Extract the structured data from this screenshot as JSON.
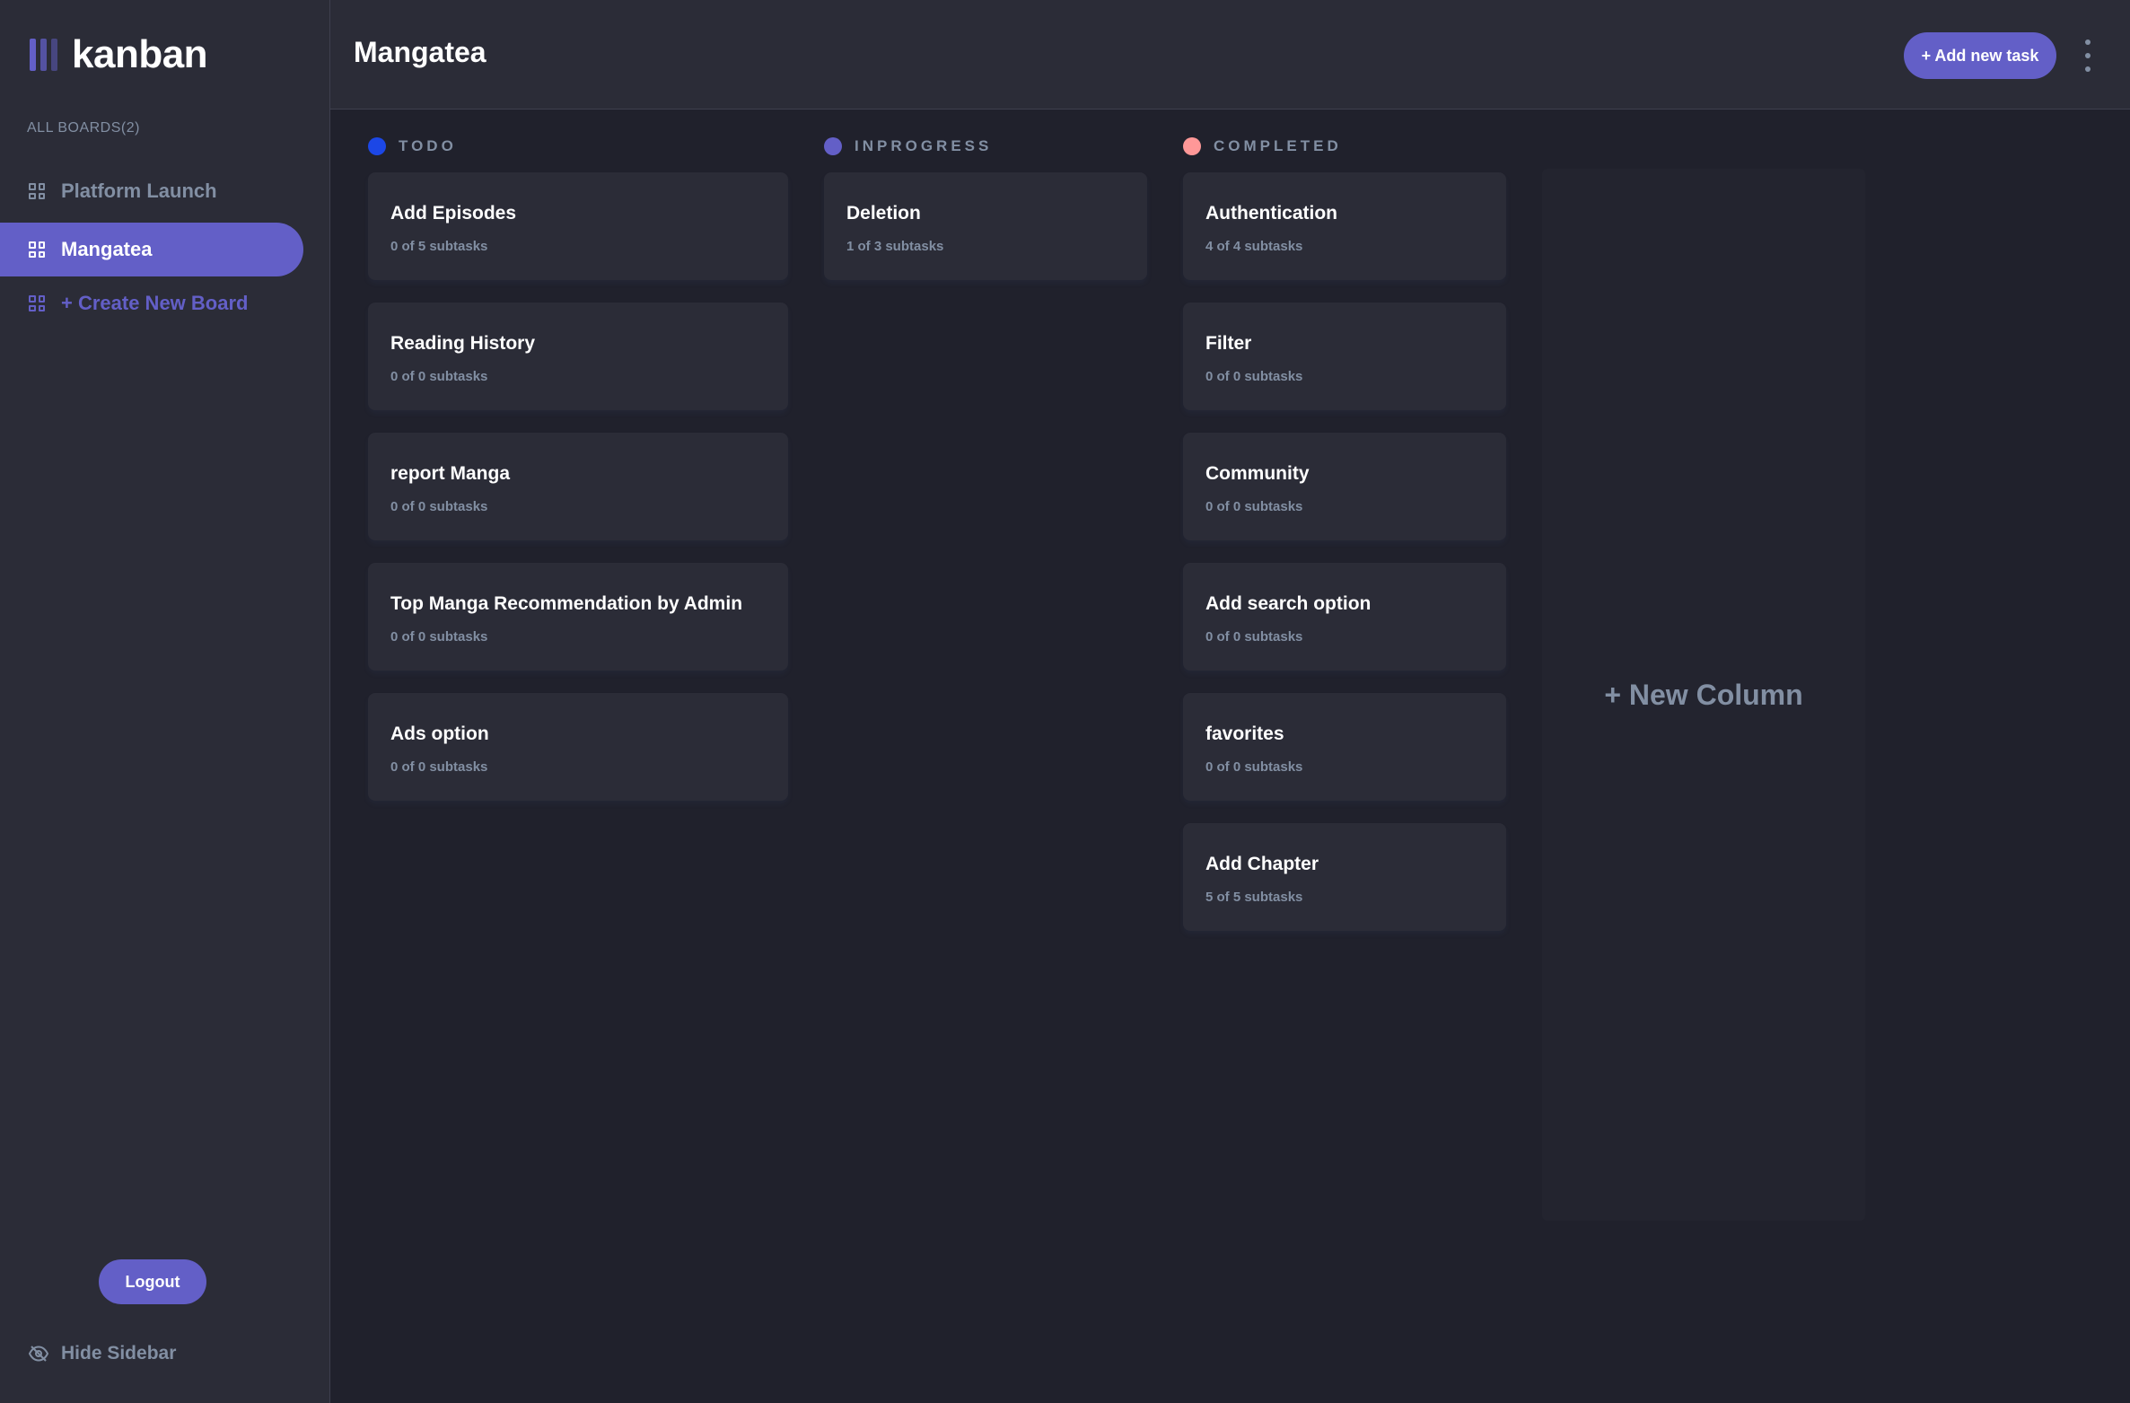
{
  "app": {
    "logo_text": "kanban"
  },
  "sidebar": {
    "heading": "ALL BOARDS(2)",
    "boards": [
      {
        "label": "Platform Launch",
        "active": false
      },
      {
        "label": "Mangatea",
        "active": true
      }
    ],
    "create_label": "+ Create New Board",
    "logout_label": "Logout",
    "hide_label": "Hide Sidebar"
  },
  "header": {
    "title": "Mangatea",
    "add_task_label": "+ Add new task"
  },
  "columns": [
    {
      "name": "TODO",
      "color": "#1c47e6",
      "tasks": [
        {
          "title": "Add Episodes",
          "subtasks": "0 of 5 subtasks"
        },
        {
          "title": "Reading History",
          "subtasks": "0 of 0 subtasks"
        },
        {
          "title": "report Manga",
          "subtasks": "0 of 0 subtasks"
        },
        {
          "title": "Top Manga Recommendation by Admin",
          "subtasks": "0 of 0 subtasks"
        },
        {
          "title": "Ads option",
          "subtasks": "0 of 0 subtasks"
        }
      ]
    },
    {
      "name": "INPROGRESS",
      "color": "#635fc7",
      "tasks": [
        {
          "title": "Deletion",
          "subtasks": "1 of 3 subtasks"
        }
      ]
    },
    {
      "name": "COMPLETED",
      "color": "#ff9898",
      "tasks": [
        {
          "title": "Authentication",
          "subtasks": "4 of 4 subtasks"
        },
        {
          "title": "Filter",
          "subtasks": "0 of 0 subtasks"
        },
        {
          "title": "Community",
          "subtasks": "0 of 0 subtasks"
        },
        {
          "title": "Add search option",
          "subtasks": "0 of 0 subtasks"
        },
        {
          "title": "favorites",
          "subtasks": "0 of 0 subtasks"
        },
        {
          "title": "Add Chapter",
          "subtasks": "5 of 5 subtasks"
        }
      ]
    }
  ],
  "new_column_label": "+ New Column",
  "theme": {
    "accent": "#635fc7",
    "background": "#20212c",
    "panel": "#2b2c37",
    "muted_text": "#828fa3"
  }
}
